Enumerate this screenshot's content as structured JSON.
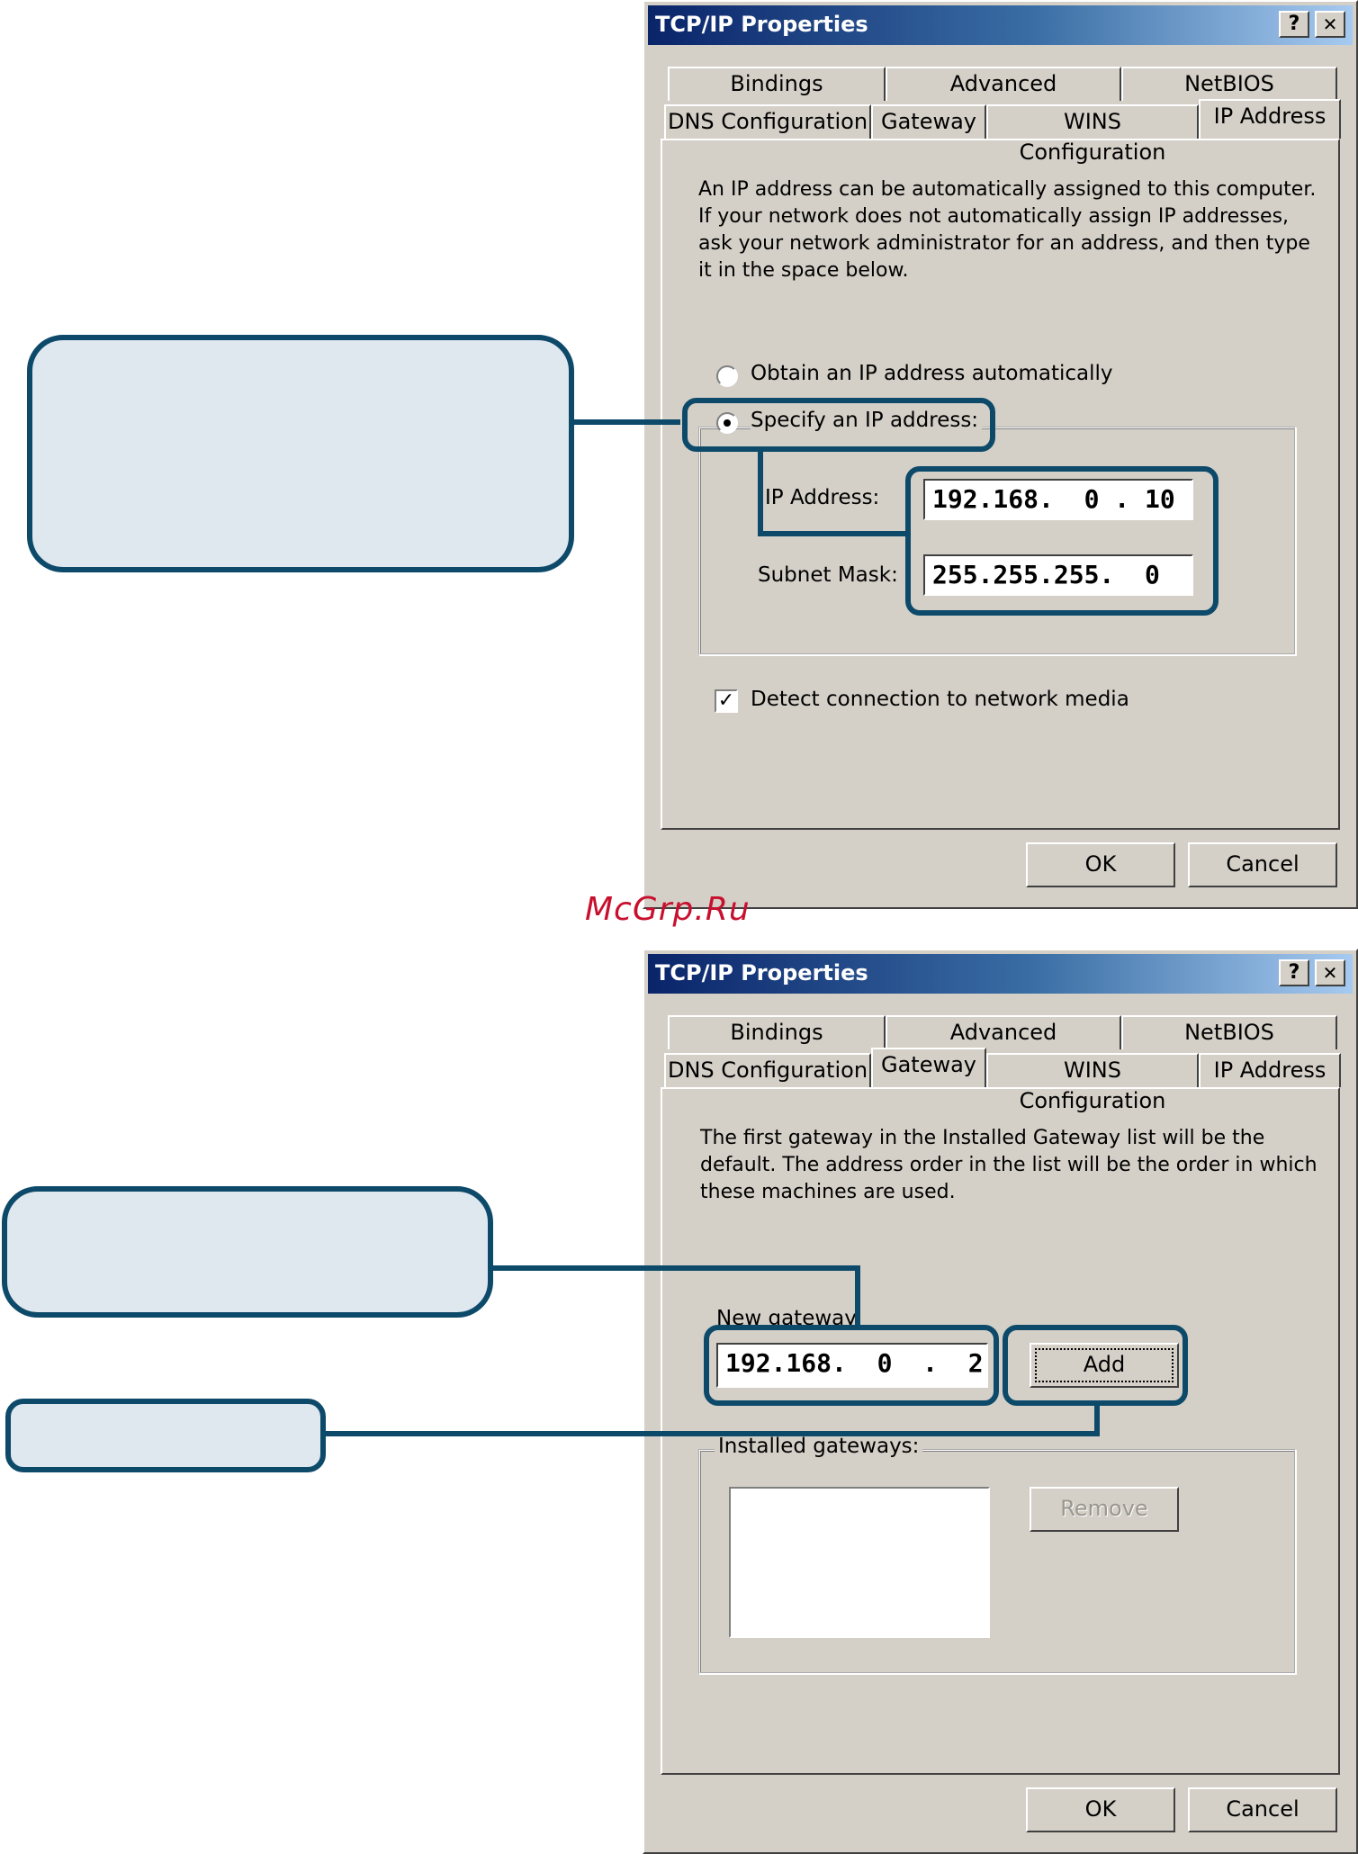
{
  "dialog1": {
    "title": "TCP/IP Properties",
    "help_label": "?",
    "close_label": "✕",
    "tabs_row1": [
      "Bindings",
      "Advanced",
      "NetBIOS"
    ],
    "tabs_row2": [
      "DNS Configuration",
      "Gateway",
      "WINS Configuration",
      "IP Address"
    ],
    "active_tab": "IP Address",
    "description": "An IP address can be automatically assigned to this computer. If your network does not automatically assign IP addresses, ask your network administrator for an address, and then type it in the space below.",
    "radio_auto_label": "Obtain an IP address automatically",
    "radio_specify_label": "Specify an IP address:",
    "ip_label": "IP Address:",
    "ip_value": "192.168.  0 . 10",
    "mask_label": "Subnet Mask:",
    "mask_value": "255.255.255.  0",
    "detect_label": "Detect connection to network media",
    "detect_checked": true,
    "ok_label": "OK",
    "cancel_label": "Cancel"
  },
  "watermark": "McGrp.Ru",
  "dialog2": {
    "title": "TCP/IP Properties",
    "help_label": "?",
    "close_label": "✕",
    "tabs_row1": [
      "Bindings",
      "Advanced",
      "NetBIOS"
    ],
    "tabs_row2": [
      "DNS Configuration",
      "Gateway",
      "WINS Configuration",
      "IP Address"
    ],
    "active_tab": "Gateway",
    "description": "The first gateway in the Installed Gateway list will be the default. The address order in the list will be the order in which these machines are used.",
    "new_gateway_label": "New gateway:",
    "gateway_value": "192.168.  0  .  2",
    "add_label": "Add",
    "installed_label": "Installed gateways:",
    "remove_label": "Remove",
    "ok_label": "OK",
    "cancel_label": "Cancel"
  },
  "colors": {
    "callout_border": "#0d4a6a",
    "callout_fill": "#dfe7ef",
    "dialog_bg": "#d4d0c8",
    "watermark": "#c8102e"
  }
}
